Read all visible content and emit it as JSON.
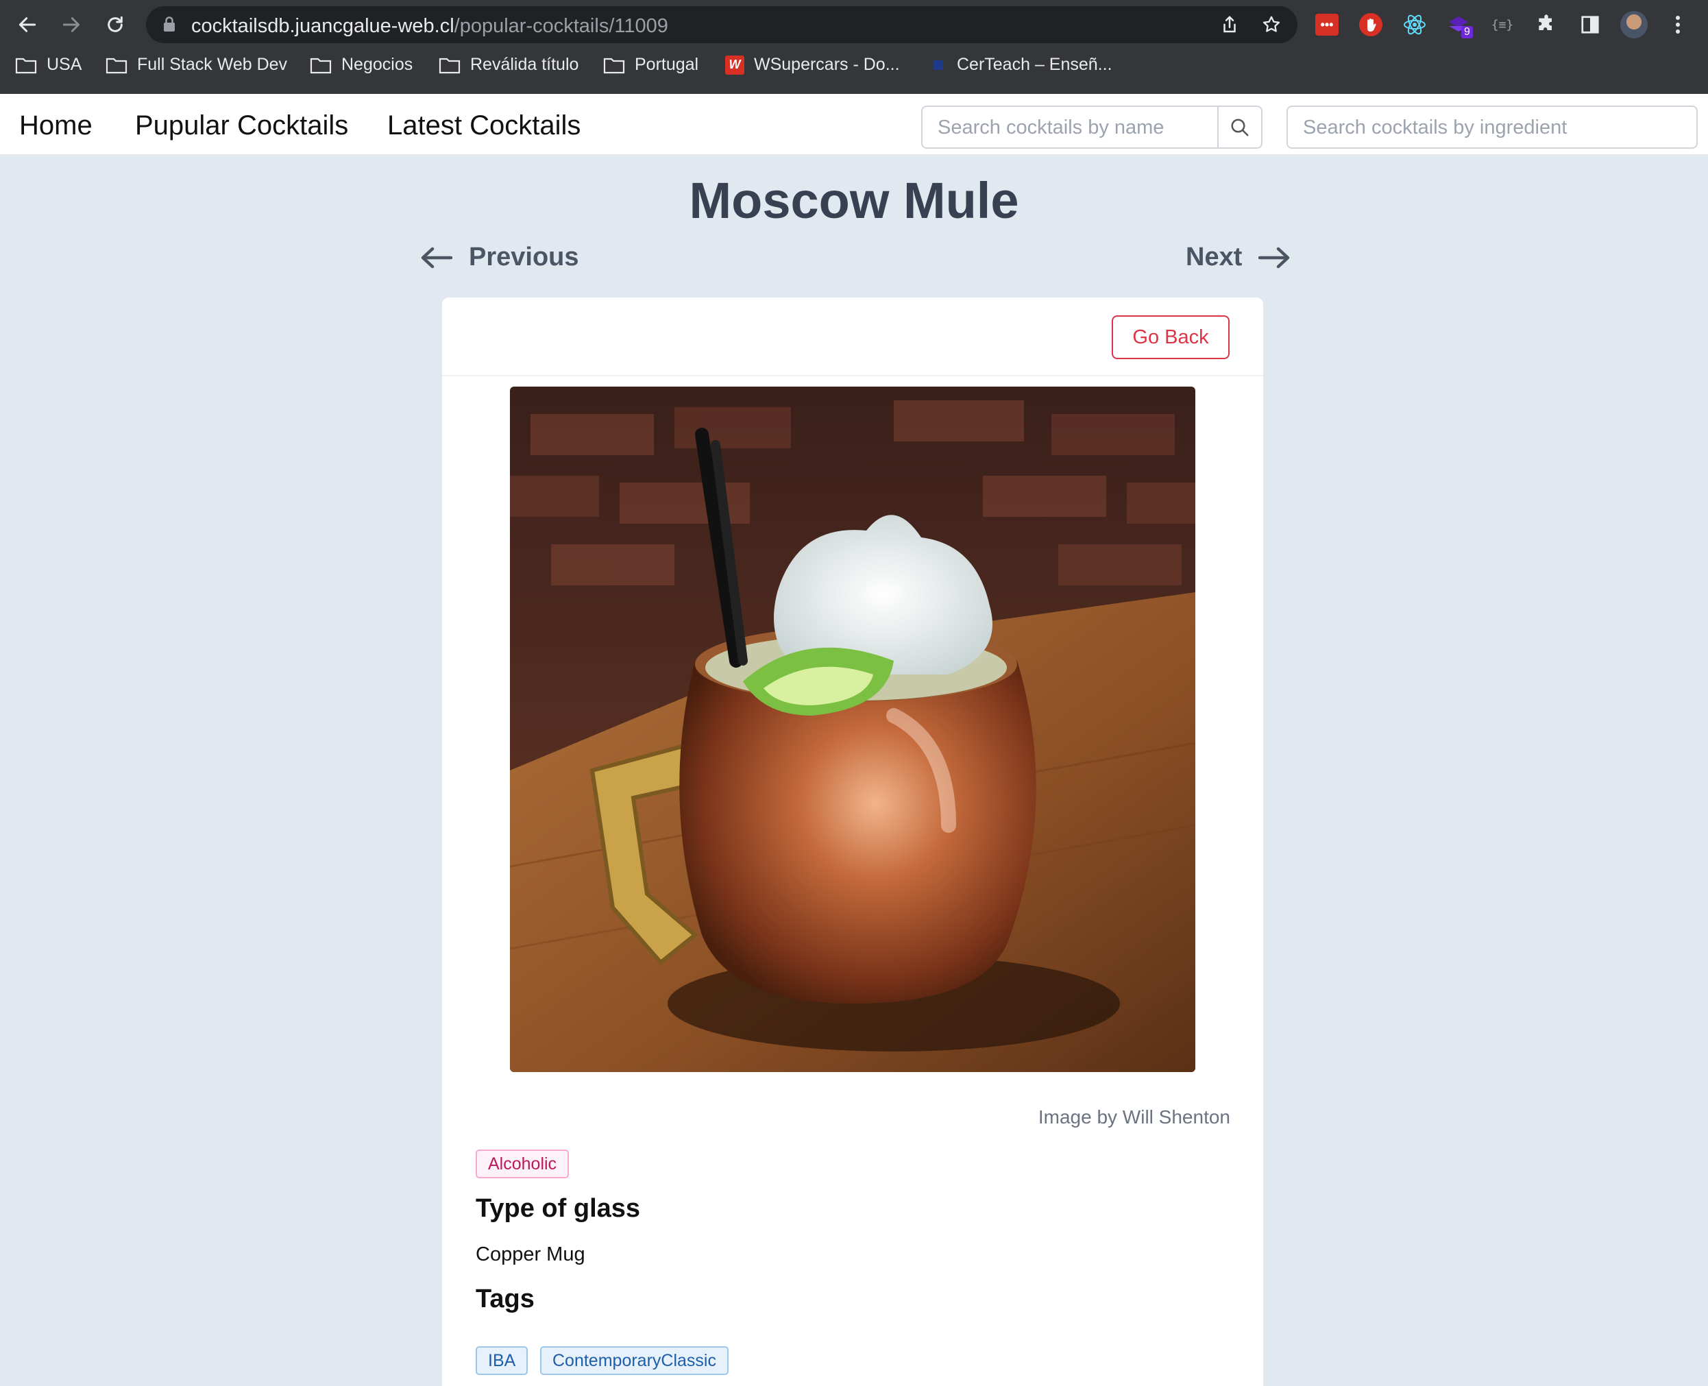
{
  "browser": {
    "url_host": "cocktailsdb.juancgalue-web.cl",
    "url_path": "/popular-cocktails/11009",
    "extension_badge": "9",
    "bookmarks": [
      "USA",
      "Full Stack Web Dev",
      "Negocios",
      "Reválida título",
      "Portugal",
      "WSupercars - Do...",
      "CerTeach – Enseñ..."
    ]
  },
  "navbar": {
    "links": [
      "Home",
      "Pupular Cocktails",
      "Latest Cocktails"
    ],
    "search_name_placeholder": "Search cocktails by name",
    "search_ingredient_placeholder": "Search cocktails by ingredient"
  },
  "page": {
    "title": "Moscow Mule",
    "previous": "Previous",
    "next": "Next"
  },
  "card": {
    "go_back": "Go Back",
    "image_credit": "Image by Will Shenton",
    "category_badge": "Alcoholic",
    "glass_heading": "Type of glass",
    "glass_value": "Copper Mug",
    "tags_heading": "Tags",
    "tags": [
      "IBA",
      "ContemporaryClassic"
    ]
  },
  "colors": {
    "page_bg": "#e2e8f0",
    "danger": "#dc3545",
    "chrome": "#35363a"
  }
}
